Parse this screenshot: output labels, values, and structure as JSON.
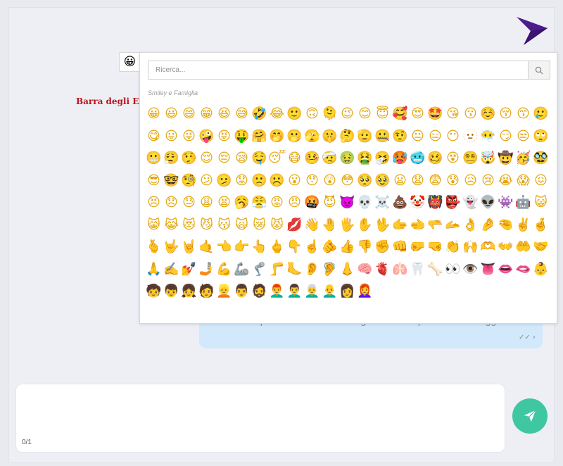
{
  "annotation": "Barra degli Emoji",
  "emoji_toggle": "😀",
  "search": {
    "placeholder": "Ricerca..."
  },
  "category": "Smiley e Famiglia",
  "emojis": [
    "😀",
    "😃",
    "😄",
    "😁",
    "😆",
    "😅",
    "🤣",
    "😂",
    "🙂",
    "🙃",
    "🫠",
    "😉",
    "😊",
    "😇",
    "🥰",
    "😍",
    "🤩",
    "😘",
    "😗",
    "☺️",
    "😚",
    "😙",
    "🥲",
    "😋",
    "😛",
    "😜",
    "🤪",
    "😝",
    "🤑",
    "🤗",
    "🤭",
    "🫢",
    "🫣",
    "🤫",
    "🤔",
    "🫡",
    "🤐",
    "🤨",
    "😐",
    "😑",
    "😶",
    "🫥",
    "😶‍🌫️",
    "😏",
    "😒",
    "🙄",
    "😬",
    "😮‍💨",
    "🤥",
    "😌",
    "😔",
    "😪",
    "🤤",
    "😴",
    "😷",
    "🤒",
    "🤕",
    "🤢",
    "🤮",
    "🤧",
    "🥵",
    "🥶",
    "🥴",
    "😵",
    "😵‍💫",
    "🤯",
    "🤠",
    "🥳",
    "🥸",
    "😎",
    "🤓",
    "🧐",
    "😕",
    "🫤",
    "😟",
    "🙁",
    "☹️",
    "😮",
    "😯",
    "😲",
    "😳",
    "🥺",
    "🥹",
    "😦",
    "😧",
    "😨",
    "😰",
    "😥",
    "😢",
    "😭",
    "😱",
    "😖",
    "😣",
    "😞",
    "😓",
    "😩",
    "😫",
    "🥱",
    "😤",
    "😡",
    "😠",
    "🤬",
    "😈",
    "👿",
    "💀",
    "☠️",
    "💩",
    "🤡",
    "👹",
    "👺",
    "👻",
    "👽",
    "👾",
    "🤖",
    "😺",
    "😸",
    "😹",
    "😻",
    "😼",
    "😽",
    "🙀",
    "😿",
    "😾",
    "💋",
    "👋",
    "🤚",
    "🖐️",
    "✋",
    "🖖",
    "🫱",
    "🫲",
    "🫳",
    "🫴",
    "👌",
    "🤌",
    "🤏",
    "✌️",
    "🤞",
    "🫰",
    "🤟",
    "🤘",
    "🤙",
    "👈",
    "👉",
    "👆",
    "🖕",
    "👇",
    "☝️",
    "🫵",
    "👍",
    "👎",
    "✊",
    "👊",
    "🤛",
    "🤜",
    "👏",
    "🙌",
    "🫶",
    "👐",
    "🤲",
    "🤝",
    "🙏",
    "✍️",
    "💅",
    "🤳",
    "💪",
    "🦾",
    "🦿",
    "🦵",
    "🦶",
    "👂",
    "🦻",
    "👃",
    "🧠",
    "🫀",
    "🫁",
    "🦷",
    "🦴",
    "👀",
    "👁️",
    "👅",
    "👄",
    "🫦",
    "👶",
    "🧒",
    "👦",
    "👧",
    "🧑",
    "👱",
    "👨",
    "🧔",
    "👨‍🦰",
    "👨‍🦱",
    "👨‍🦳",
    "👨‍🦲",
    "👩",
    "👩‍🦰"
  ],
  "message": {
    "text": "Errore: il provider non è stato in grado di recuperare il messaggio inviato",
    "ticks": "✓✓",
    "chevron": "›"
  },
  "composer": {
    "counter": "0/1"
  },
  "icons": {
    "logo": "logo-icon",
    "search": "search-icon",
    "send": "send-icon"
  },
  "colors": {
    "brand": "#4b1c8a",
    "send_button": "#3ec7a1",
    "annotation": "#b8141c",
    "bubble": "#d2e9fb"
  }
}
